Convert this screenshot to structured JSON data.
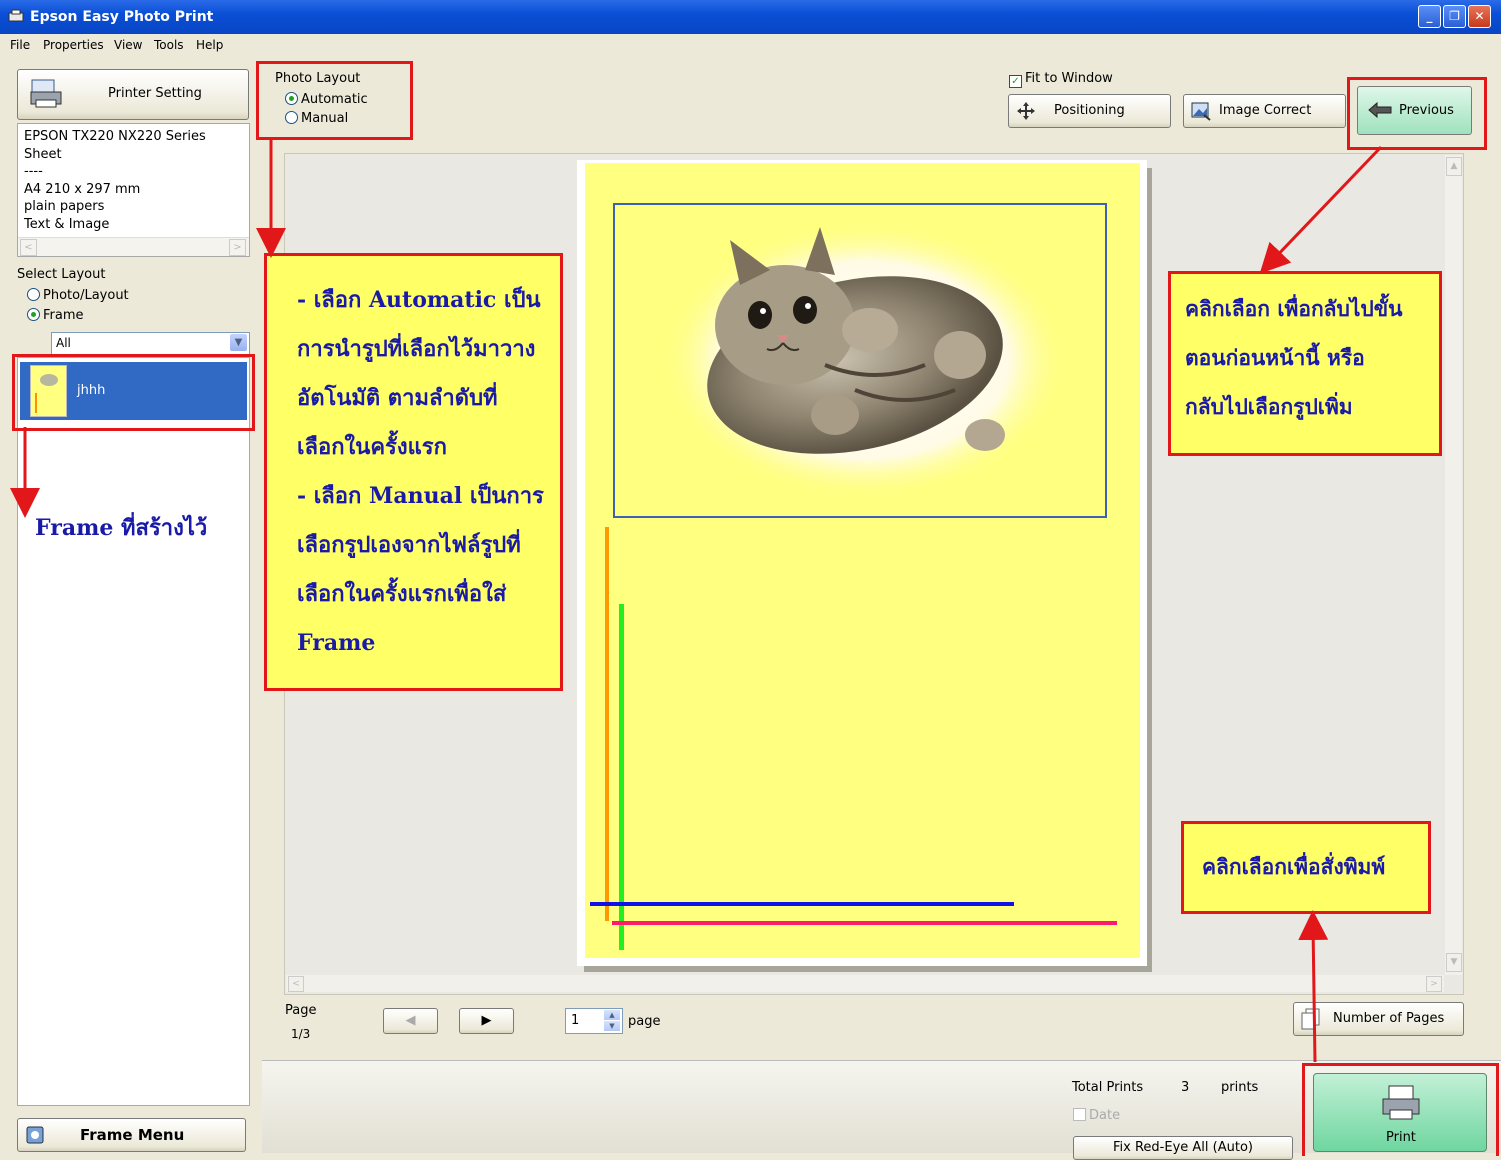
{
  "window": {
    "title": "Epson Easy Photo Print"
  },
  "menu": [
    "File",
    "Properties",
    "View",
    "Tools",
    "Help"
  ],
  "printer": {
    "button_label": "Printer Setting",
    "info_lines": [
      "EPSON TX220 NX220 Series",
      "Sheet",
      "----",
      "A4 210 x 297 mm",
      "plain papers",
      "Text & Image"
    ]
  },
  "select_layout": {
    "label": "Select Layout",
    "options": [
      "Photo/Layout",
      "Frame"
    ],
    "selected": "Frame",
    "dropdown_value": "All"
  },
  "frame_list": [
    {
      "name": "jhhh"
    }
  ],
  "frame_menu_label": "Frame Menu",
  "photo_layout": {
    "label": "Photo Layout",
    "options": [
      "Automatic",
      "Manual"
    ],
    "selected": "Automatic"
  },
  "toolbar": {
    "fit_to_window": "Fit to Window",
    "positioning": "Positioning",
    "image_correct": "Image Correct",
    "previous": "Previous"
  },
  "pager": {
    "page_label": "Page",
    "page_count": "1/3",
    "page_value": "1",
    "page_unit": "page",
    "number_of_pages": "Number of Pages"
  },
  "footer": {
    "total_prints_label": "Total Prints",
    "total_prints_value": "3",
    "prints_unit": "prints",
    "date_label": "Date",
    "fix_red_eye": "Fix Red-Eye All (Auto)",
    "print": "Print"
  },
  "annotations": {
    "frame_note": "Frame ที่สร้างไว้",
    "layout_note": [
      "- เลือก Automatic เป็น",
      "การนำรูปที่เลือกไว้มาวาง",
      "อัตโนมัติ ตามลำดับที่",
      "เลือกในครั้งแรก",
      "- เลือก Manual เป็นการ",
      "เลือกรูปเองจากไฟล์รูปที่",
      "เลือกในครั้งแรกเพื่อใส่",
      "Frame"
    ],
    "previous_note": [
      "คลิกเลือก เพื่อกลับไปขั้น",
      "ตอนก่อนหน้านี้  หรือ",
      "กลับไปเลือกรูปเพิ่ม"
    ],
    "print_note": "คลิกเลือกเพื่อสั่งพิมพ์"
  },
  "colors": {
    "titlebar": "#0a4fd6",
    "page_bg": "#ffff80",
    "annotation_bg": "#ffff66",
    "annotation_border": "#e2171a",
    "annotation_text": "#1a1aa8",
    "print_button": "#6fd6a0"
  }
}
